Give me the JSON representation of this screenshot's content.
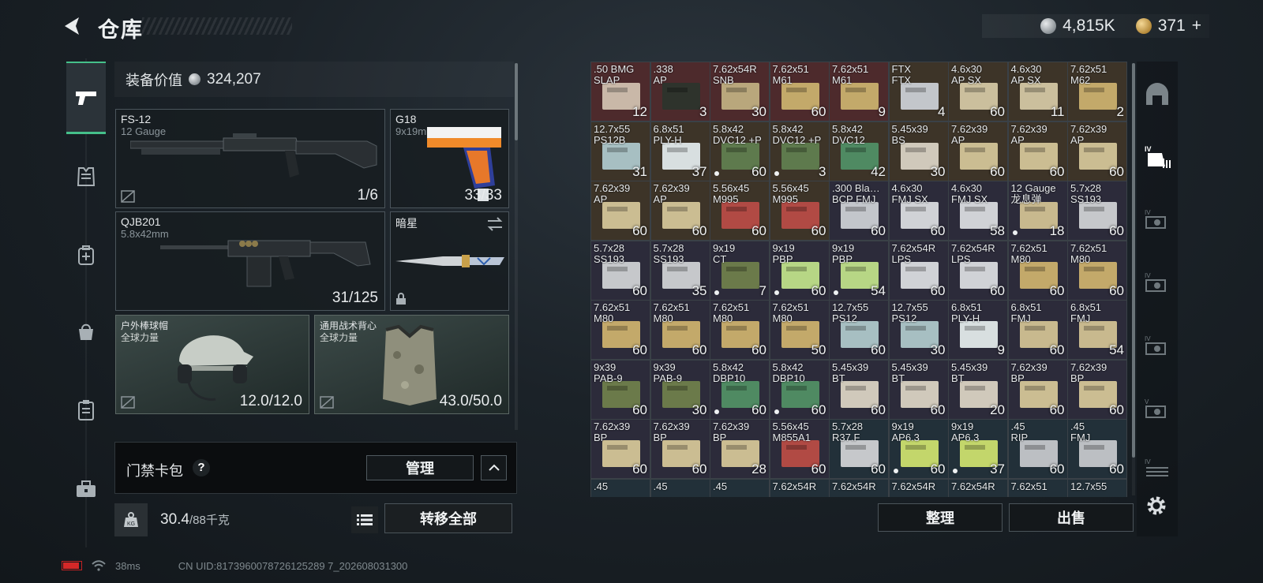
{
  "header": {
    "title": "仓库",
    "currency_silver": "4,815K",
    "currency_gold": "371",
    "currency_add": "+"
  },
  "equipment": {
    "value_label": "装备价值",
    "value": "324,207",
    "slots": [
      {
        "name": "FS-12",
        "sub": "12 Gauge",
        "count": "1/6"
      },
      {
        "name": "G18",
        "sub": "9x19mm",
        "count": "33/33"
      },
      {
        "name": "QJB201",
        "sub": "5.8x42mm",
        "count": "31/125"
      },
      {
        "name": "暗星",
        "sub": "",
        "count": ""
      },
      {
        "name": "户外棒球帽",
        "sub": "全球力量",
        "count": "12.0/12.0"
      },
      {
        "name": "通用战术背心",
        "sub": "全球力量",
        "count": "43.0/50.0"
      }
    ]
  },
  "keycard": {
    "label": "门禁卡包",
    "help": "?",
    "manage_label": "管理"
  },
  "inventory": {
    "weight_current": "30.4",
    "weight_max": "/88千克",
    "transfer_label": "转移全部"
  },
  "status": {
    "ping": "38ms",
    "uid": "CN UID:8173960078726125289 7_202608031300"
  },
  "grid_actions": {
    "sort_label": "整理",
    "sell_label": "出售"
  },
  "warehouse_items": [
    {
      "name": ".50 BMG\nSLAP",
      "count": "12",
      "tone": "red",
      "box": "#c9b8a8",
      "dot": false
    },
    {
      "name": ".338\nAP",
      "count": "3",
      "tone": "red",
      "box": "#2e332c",
      "dot": false
    },
    {
      "name": "7.62x54R\nSNB",
      "count": "30",
      "tone": "red",
      "box": "#b9a77c",
      "dot": false
    },
    {
      "name": "7.62x51\nM61",
      "count": "60",
      "tone": "red",
      "box": "#c3a96a",
      "dot": false
    },
    {
      "name": "7.62x51\nM61",
      "count": "9",
      "tone": "red",
      "box": "#c3a96a",
      "dot": false
    },
    {
      "name": "FTX\nFTX",
      "count": "4",
      "tone": "brown",
      "box": "#c3c6cb",
      "dot": false
    },
    {
      "name": "4.6x30\nAP SX",
      "count": "60",
      "tone": "brown",
      "box": "#cbbf9d",
      "dot": false
    },
    {
      "name": "4.6x30\nAP SX",
      "count": "11",
      "tone": "brown",
      "box": "#cbbf9d",
      "dot": false
    },
    {
      "name": "7.62x51\nM62",
      "count": "2",
      "tone": "brown",
      "box": "#c3a96a",
      "dot": false
    },
    {
      "name": "12.7x55\nPS12B",
      "count": "31",
      "tone": "brown",
      "box": "#a7bfc2",
      "dot": false
    },
    {
      "name": "6.8x51\nPLY-H",
      "count": "37",
      "tone": "brown",
      "box": "#d8dfe0",
      "dot": false
    },
    {
      "name": "5.8x42\nDVC12 +P",
      "count": "60",
      "tone": "brown",
      "box": "#5e7a4d",
      "dot": true
    },
    {
      "name": "5.8x42\nDVC12 +P",
      "count": "3",
      "tone": "brown",
      "box": "#5e7a4d",
      "dot": true
    },
    {
      "name": "5.8x42\nDVC12",
      "count": "42",
      "tone": "brown",
      "box": "#4f8a62",
      "dot": false
    },
    {
      "name": "5.45x39\nBS",
      "count": "30",
      "tone": "brown",
      "box": "#d0c9bb",
      "dot": false
    },
    {
      "name": "7.62x39\nAP",
      "count": "60",
      "tone": "brown",
      "box": "#cbbd92",
      "dot": false
    },
    {
      "name": "7.62x39\nAP",
      "count": "60",
      "tone": "brown",
      "box": "#cbbd92",
      "dot": false
    },
    {
      "name": "7.62x39\nAP",
      "count": "60",
      "tone": "brown",
      "box": "#cbbd92",
      "dot": false
    },
    {
      "name": "7.62x39\nAP",
      "count": "60",
      "tone": "brown",
      "box": "#cbbd92",
      "dot": false
    },
    {
      "name": "7.62x39\nAP",
      "count": "60",
      "tone": "brown",
      "box": "#cbbd92",
      "dot": false
    },
    {
      "name": "5.56x45\nM995",
      "count": "60",
      "tone": "brown",
      "box": "#b14a44",
      "dot": false
    },
    {
      "name": "5.56x45\nM995",
      "count": "60",
      "tone": "brown",
      "box": "#b14a44",
      "dot": false
    },
    {
      "name": ".300 Bla…\nBCP FMJ",
      "count": "60",
      "tone": "purple",
      "box": "#c3c6cb",
      "dot": false
    },
    {
      "name": "4.6x30\nFMJ SX",
      "count": "60",
      "tone": "purple",
      "box": "#d0d2d6",
      "dot": false
    },
    {
      "name": "4.6x30\nFMJ SX",
      "count": "58",
      "tone": "purple",
      "box": "#d0d2d6",
      "dot": false
    },
    {
      "name": "12 Gauge\n龙息弹",
      "count": "18",
      "tone": "purple",
      "box": "#c8b98e",
      "dot": true
    },
    {
      "name": "5.7x28\nSS193",
      "count": "60",
      "tone": "purple",
      "box": "#c6c8cb",
      "dot": false
    },
    {
      "name": "5.7x28\nSS193",
      "count": "60",
      "tone": "purple",
      "box": "#c6c8cb",
      "dot": false
    },
    {
      "name": "5.7x28\nSS193",
      "count": "35",
      "tone": "purple",
      "box": "#c6c8cb",
      "dot": false
    },
    {
      "name": "9x19\nCT",
      "count": "7",
      "tone": "purple",
      "box": "#6b7a4a",
      "dot": true
    },
    {
      "name": "9x19\nPBP",
      "count": "60",
      "tone": "purple",
      "box": "#b7d685",
      "dot": true
    },
    {
      "name": "9x19\nPBP",
      "count": "54",
      "tone": "purple",
      "box": "#b7d685",
      "dot": true
    },
    {
      "name": "7.62x54R\nLPS",
      "count": "60",
      "tone": "purple",
      "box": "#d0d2d6",
      "dot": false
    },
    {
      "name": "7.62x54R\nLPS",
      "count": "60",
      "tone": "purple",
      "box": "#d0d2d6",
      "dot": false
    },
    {
      "name": "7.62x51\nM80",
      "count": "60",
      "tone": "purple",
      "box": "#c3a96a",
      "dot": false
    },
    {
      "name": "7.62x51\nM80",
      "count": "60",
      "tone": "purple",
      "box": "#c3a96a",
      "dot": false
    },
    {
      "name": "7.62x51\nM80",
      "count": "60",
      "tone": "purple",
      "box": "#c3a96a",
      "dot": false
    },
    {
      "name": "7.62x51\nM80",
      "count": "60",
      "tone": "purple",
      "box": "#c3a96a",
      "dot": false
    },
    {
      "name": "7.62x51\nM80",
      "count": "60",
      "tone": "purple",
      "box": "#c3a96a",
      "dot": false
    },
    {
      "name": "7.62x51\nM80",
      "count": "50",
      "tone": "purple",
      "box": "#c3a96a",
      "dot": false
    },
    {
      "name": "12.7x55\nPS12",
      "count": "60",
      "tone": "purple",
      "box": "#a7bfc2",
      "dot": false
    },
    {
      "name": "12.7x55\nPS12",
      "count": "30",
      "tone": "purple",
      "box": "#a7bfc2",
      "dot": false
    },
    {
      "name": "6.8x51\nPLY-H",
      "count": "9",
      "tone": "purple",
      "box": "#d8dfe0",
      "dot": false
    },
    {
      "name": "6.8x51\nFMJ",
      "count": "60",
      "tone": "purple",
      "box": "#c8b98e",
      "dot": false
    },
    {
      "name": "6.8x51\nFMJ",
      "count": "54",
      "tone": "purple",
      "box": "#c8b98e",
      "dot": false
    },
    {
      "name": "9x39\nPAB-9",
      "count": "60",
      "tone": "purple",
      "box": "#6b7a4a",
      "dot": false
    },
    {
      "name": "9x39\nPAB-9",
      "count": "30",
      "tone": "purple",
      "box": "#6b7a4a",
      "dot": false
    },
    {
      "name": "5.8x42\nDBP10",
      "count": "60",
      "tone": "purple",
      "box": "#4f8a62",
      "dot": true
    },
    {
      "name": "5.8x42\nDBP10",
      "count": "60",
      "tone": "purple",
      "box": "#4f8a62",
      "dot": true
    },
    {
      "name": "5.45x39\nBT",
      "count": "60",
      "tone": "purple",
      "box": "#d0c9bb",
      "dot": false
    },
    {
      "name": "5.45x39\nBT",
      "count": "60",
      "tone": "purple",
      "box": "#d0c9bb",
      "dot": false
    },
    {
      "name": "5.45x39\nBT",
      "count": "20",
      "tone": "purple",
      "box": "#d0c9bb",
      "dot": false
    },
    {
      "name": "7.62x39\nBP",
      "count": "60",
      "tone": "purple",
      "box": "#cbbd92",
      "dot": false
    },
    {
      "name": "7.62x39\nBP",
      "count": "60",
      "tone": "purple",
      "box": "#cbbd92",
      "dot": false
    },
    {
      "name": "7.62x39\nBP",
      "count": "60",
      "tone": "purple",
      "box": "#cbbd92",
      "dot": false
    },
    {
      "name": "7.62x39\nBP",
      "count": "60",
      "tone": "purple",
      "box": "#cbbd92",
      "dot": false
    },
    {
      "name": "7.62x39\nBP",
      "count": "28",
      "tone": "purple",
      "box": "#cbbd92",
      "dot": false
    },
    {
      "name": "5.56x45\nM855A1",
      "count": "60",
      "tone": "purple",
      "box": "#b14a44",
      "dot": false
    },
    {
      "name": "5.7x28\nR37.F",
      "count": "60",
      "tone": "blue",
      "box": "#c6c8cb",
      "dot": false
    },
    {
      "name": "9x19\nAP6.3",
      "count": "60",
      "tone": "blue",
      "box": "#c3d66b",
      "dot": true
    },
    {
      "name": "9x19\nAP6.3",
      "count": "37",
      "tone": "blue",
      "box": "#c3d66b",
      "dot": true
    },
    {
      "name": ".45\nRIP",
      "count": "60",
      "tone": "blue",
      "box": "#bcbfc3",
      "dot": false
    },
    {
      "name": ".45\nFMJ",
      "count": "60",
      "tone": "blue",
      "box": "#bcbfc3",
      "dot": false
    },
    {
      "name": ".45",
      "count": "",
      "tone": "blue",
      "box": "#bcbfc3",
      "dot": false
    },
    {
      "name": ".45",
      "count": "",
      "tone": "blue",
      "box": "#bcbfc3",
      "dot": false
    },
    {
      "name": ".45",
      "count": "",
      "tone": "blue",
      "box": "#bcbfc3",
      "dot": false
    },
    {
      "name": "7.62x54R",
      "count": "",
      "tone": "blue",
      "box": "#d0d2d6",
      "dot": false
    },
    {
      "name": "7.62x54R",
      "count": "",
      "tone": "blue",
      "box": "#d0d2d6",
      "dot": false
    },
    {
      "name": "7.62x54R",
      "count": "",
      "tone": "blue",
      "box": "#d0d2d6",
      "dot": false
    },
    {
      "name": "7.62x54R",
      "count": "",
      "tone": "blue",
      "box": "#d0d2d6",
      "dot": false
    },
    {
      "name": "7.62x51",
      "count": "",
      "tone": "blue",
      "box": "#c3a96a",
      "dot": false
    },
    {
      "name": "12.7x55",
      "count": "",
      "tone": "blue",
      "box": "#a7bfc2",
      "dot": false
    }
  ],
  "tone_colors": {
    "red": "#4d2a2c",
    "brown": "#3d3428",
    "purple": "#2c2b3a",
    "blue": "#223039"
  },
  "icons": {
    "sidebar": [
      "pistol-icon",
      "vest-icon",
      "backpack-icon",
      "bag-icon",
      "clipboard-icon",
      "toolbox-icon"
    ],
    "rail": [
      "helmet-icon",
      "ammo-crate-icon",
      "tag-icon",
      "tag-icon",
      "tag-icon",
      "tag-icon",
      "tag-icon"
    ]
  }
}
